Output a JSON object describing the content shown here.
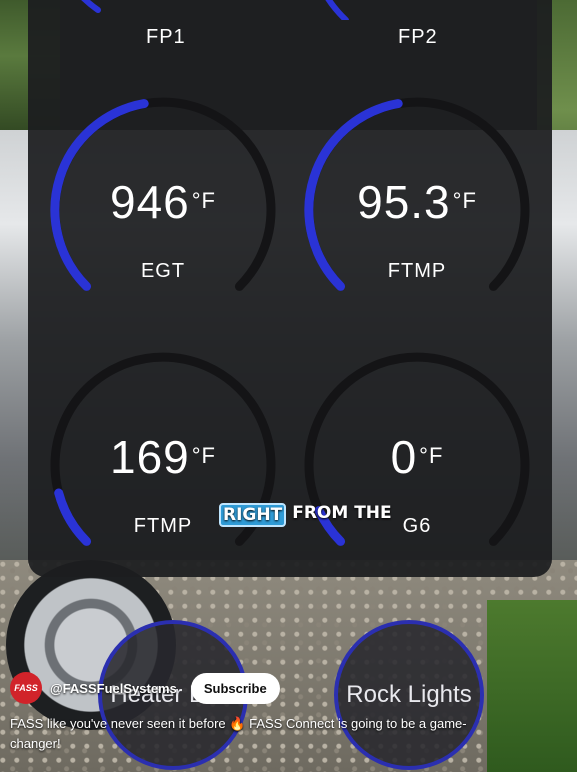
{
  "gauges_top": [
    {
      "label": "FP1"
    },
    {
      "label": "FP2"
    }
  ],
  "gauges": [
    {
      "value": "946",
      "unit": "°F",
      "label": "EGT"
    },
    {
      "value": "95.3",
      "unit": "°F",
      "label": "FTMP"
    },
    {
      "value": "169",
      "unit": "°F",
      "label": "FTMP"
    },
    {
      "value": "0",
      "unit": "°F",
      "label": "G6"
    }
  ],
  "caption": {
    "highlight": "RIGHT",
    "rest": "FROM THE"
  },
  "buttons": [
    {
      "label": "Heater Disk"
    },
    {
      "label": "Rock Lights"
    }
  ],
  "youtube": {
    "avatar_text": "FASS",
    "handle": "@FASSFuelSystems",
    "subscribe": "Subscribe",
    "description_before": "FASS like you've never seen it before",
    "description_emoji": "🔥",
    "description_after": "FASS Connect is going to be a game-changer!"
  },
  "colors": {
    "accent": "#2a33d6",
    "track": "#141416",
    "panel": "#1c1d1f"
  }
}
